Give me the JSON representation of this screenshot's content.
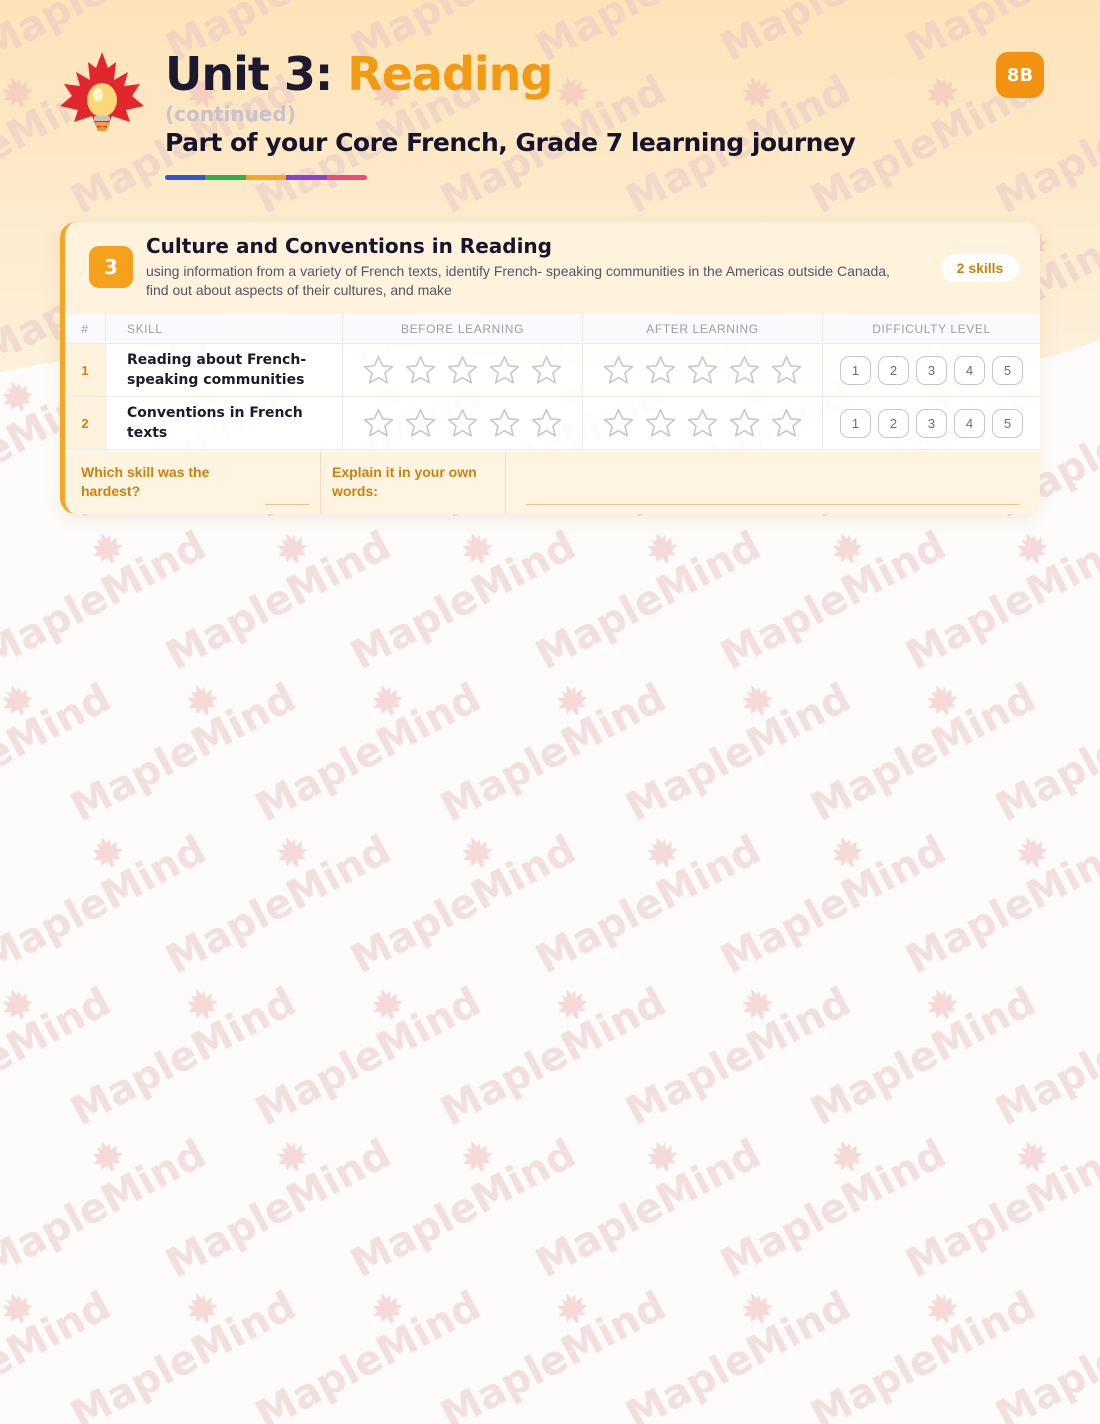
{
  "header": {
    "unit_prefix": "Unit 3: ",
    "unit_topic": "Reading",
    "continued": "(continued)",
    "subtitle": "Part of your Core French, Grade 7 learning journey",
    "page_badge": "8B"
  },
  "colors": {
    "accent": "#f29a12",
    "title_dark": "#1b1a2e",
    "rainbow": [
      "#2f56d9",
      "#2bb24c",
      "#f5a623",
      "#8a3fd9",
      "#ef4b7a"
    ]
  },
  "watermark": {
    "text": "MapleMind"
  },
  "card": {
    "number": "3",
    "title": "Culture and Conventions in Reading",
    "description": "using information from a variety of French texts, identify French- speaking communities in the Americas outside Canada, find out about aspects of their cultures, and make",
    "skills_count": "2 skills",
    "table": {
      "headers": {
        "num": "#",
        "skill": "SKILL",
        "before": "BEFORE LEARNING",
        "after": "AFTER LEARNING",
        "difficulty": "DIFFICULTY LEVEL"
      },
      "rows": [
        {
          "num": "1",
          "skill_line1": "Reading about French-",
          "skill_line2": "speaking communities"
        },
        {
          "num": "2",
          "skill_line1": "Conventions in French",
          "skill_line2": "texts"
        }
      ],
      "star_count": 5,
      "levels": [
        "1",
        "2",
        "3",
        "4",
        "5"
      ]
    },
    "reflection": {
      "question": "Which skill was the hardest?",
      "explain": "Explain it in your own words:"
    }
  }
}
